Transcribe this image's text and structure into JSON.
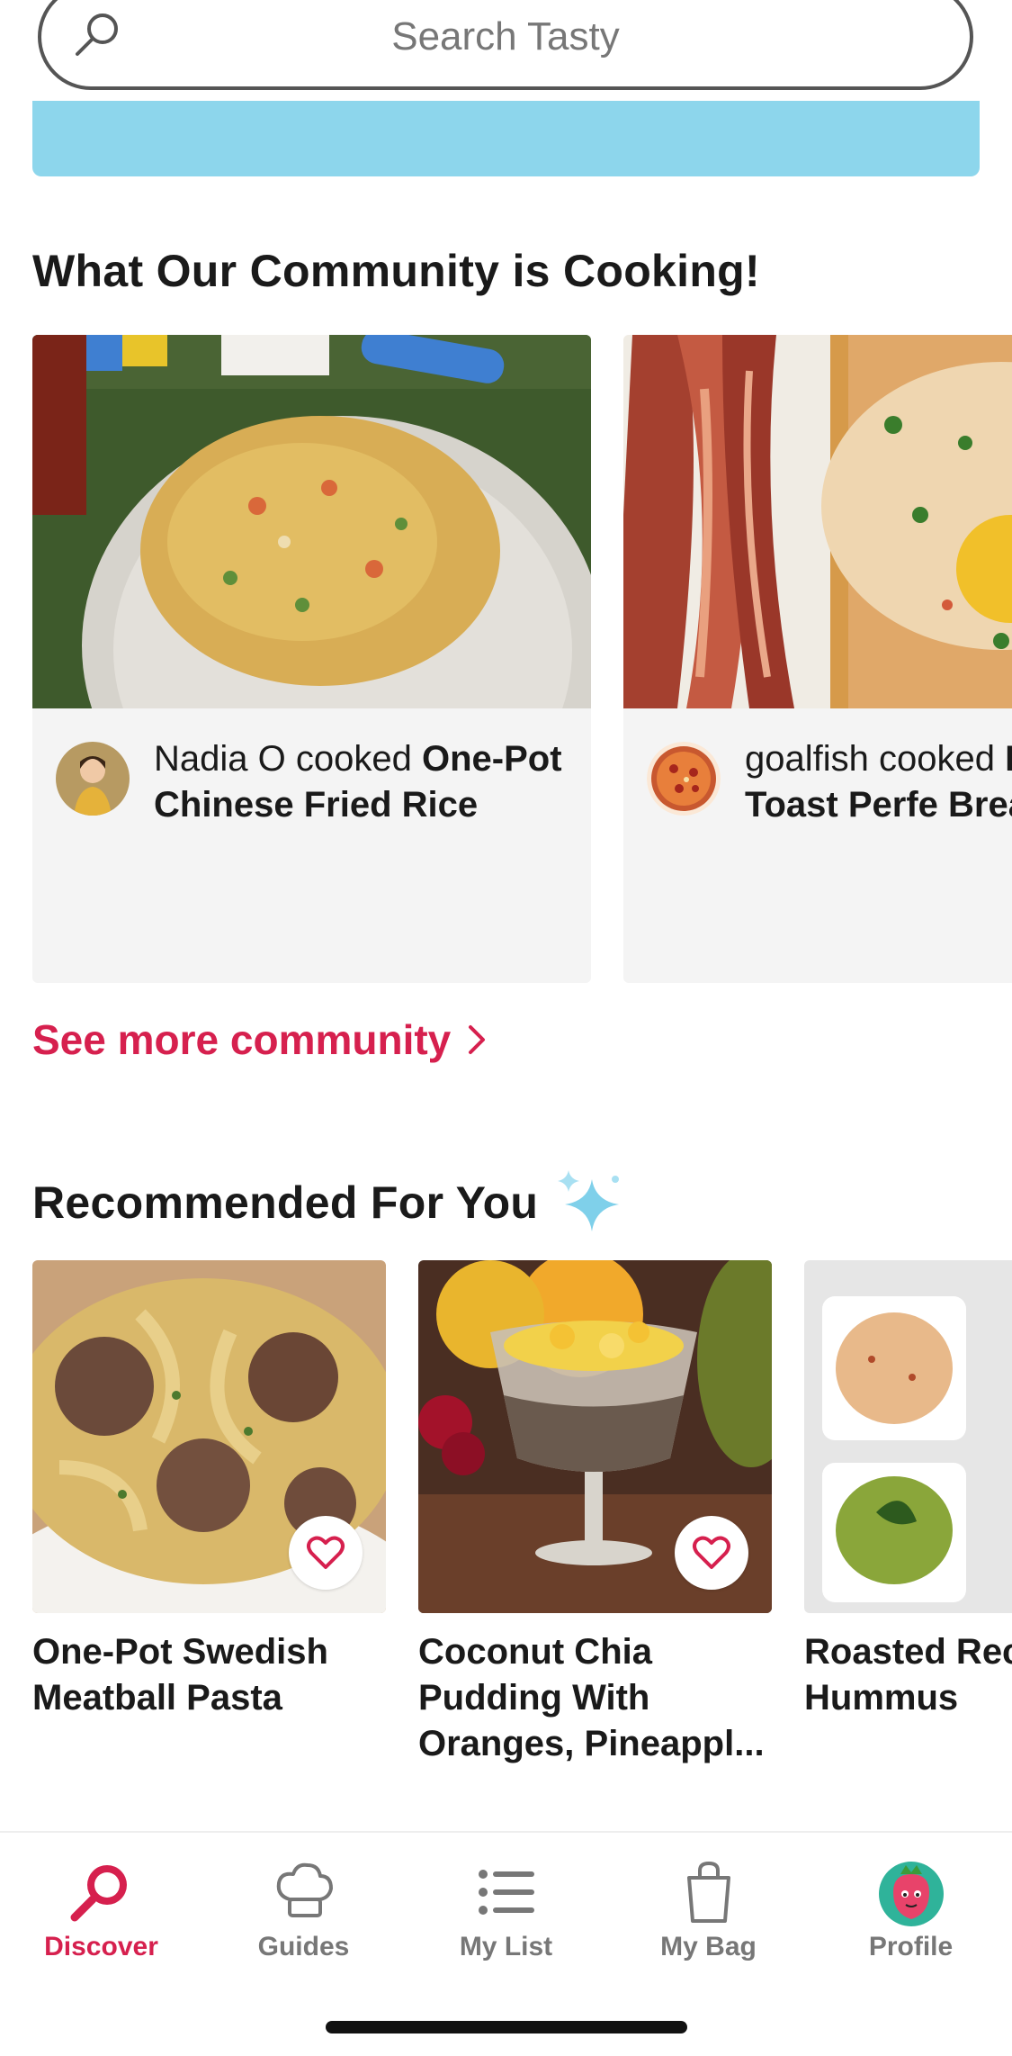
{
  "search": {
    "placeholder": "Search Tasty",
    "icon": "search-icon"
  },
  "community": {
    "title": "What Our Community is Cooking!",
    "cards": [
      {
        "user": "Nadia O",
        "verb": " cooked ",
        "recipe": "One-Pot Chinese Fried Rice"
      },
      {
        "user": "goalfish",
        "verb": " cooked ",
        "recipe": "Egg Toast Perfe Breakfast"
      }
    ],
    "see_more": "See more community"
  },
  "recommended": {
    "title": "Recommended For You",
    "title_icon": "sparkles-icon",
    "items": [
      {
        "title": "One-Pot Swedish Meatball Pasta"
      },
      {
        "title": "Coconut Chia Pudding With Oranges, Pineappl..."
      },
      {
        "title": "Roasted Rec Hummus"
      }
    ]
  },
  "nav": {
    "items": [
      {
        "label": "Discover",
        "icon": "discover-icon",
        "active": true
      },
      {
        "label": "Guides",
        "icon": "chef-hat-icon",
        "active": false
      },
      {
        "label": "My List",
        "icon": "list-icon",
        "active": false
      },
      {
        "label": "My Bag",
        "icon": "bag-icon",
        "active": false
      },
      {
        "label": "Profile",
        "icon": "profile-avatar-icon",
        "active": false
      }
    ]
  },
  "colors": {
    "accent": "#d6204e",
    "banner": "#8dd6ec",
    "card_bg": "#f4f4f4"
  }
}
